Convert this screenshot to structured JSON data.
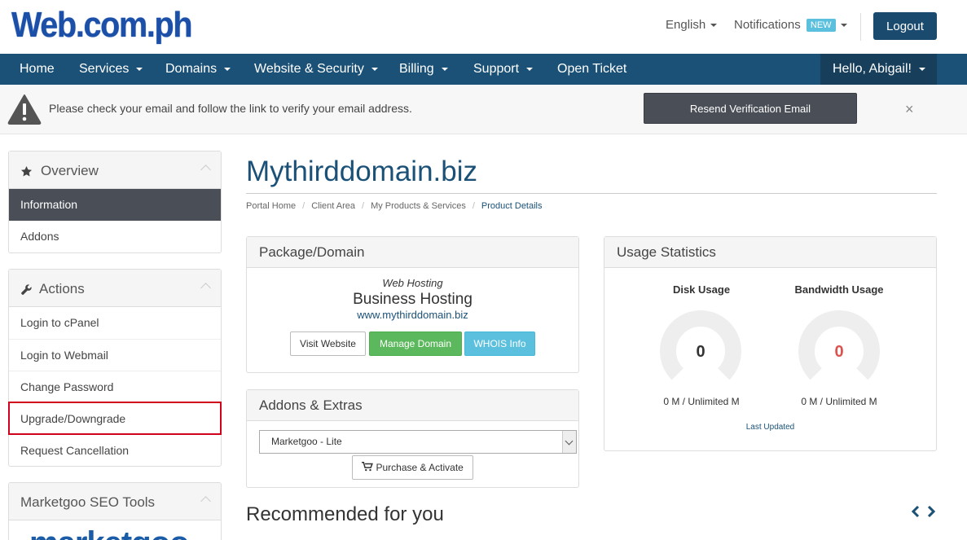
{
  "header": {
    "logo_text": "Web.com.ph",
    "language": "English",
    "notifications_label": "Notifications",
    "notifications_badge": "NEW",
    "logout_label": "Logout"
  },
  "nav": {
    "items": [
      "Home",
      "Services",
      "Domains",
      "Website & Security",
      "Billing",
      "Support",
      "Open Ticket"
    ],
    "user_greeting": "Hello, Abigail!"
  },
  "alert": {
    "message": "Please check your email and follow the link to verify your email address.",
    "resend_label": "Resend Verification Email",
    "close_glyph": "×"
  },
  "sidebar": {
    "overview": {
      "title": "Overview",
      "items": [
        "Information",
        "Addons"
      ]
    },
    "actions": {
      "title": "Actions",
      "items": [
        "Login to cPanel",
        "Login to Webmail",
        "Change Password",
        "Upgrade/Downgrade",
        "Request Cancellation"
      ]
    },
    "marketgoo": {
      "title": "Marketgoo SEO Tools",
      "logo_text": "marketgoo"
    }
  },
  "main": {
    "title": "Mythirddomain.biz",
    "breadcrumb": [
      "Portal Home",
      "Client Area",
      "My Products & Services",
      "Product Details"
    ],
    "package": {
      "heading": "Package/Domain",
      "type": "Web Hosting",
      "name": "Business Hosting",
      "domain": "www.mythirddomain.biz",
      "visit_label": "Visit Website",
      "manage_label": "Manage Domain",
      "whois_label": "WHOIS Info"
    },
    "addons": {
      "heading": "Addons & Extras",
      "selected": "Marketgoo - Lite",
      "purchase_label": "Purchase & Activate"
    },
    "usage": {
      "heading": "Usage Statistics",
      "disk_label": "Disk Usage",
      "disk_value": "0",
      "disk_text": "0 M / Unlimited M",
      "bandwidth_label": "Bandwidth Usage",
      "bandwidth_value": "0",
      "bandwidth_text": "0 M / Unlimited M",
      "last_updated": "Last Updated"
    },
    "recommended_title": "Recommended for you"
  },
  "colors": {
    "brand": "#1b5177",
    "danger": "#d0021b",
    "success": "#5cb85c",
    "info": "#5bc0de"
  },
  "icons": {
    "alert": "warning-triangle-icon",
    "overview": "star-icon",
    "actions": "wrench-icon",
    "purchase": "cart-icon"
  }
}
